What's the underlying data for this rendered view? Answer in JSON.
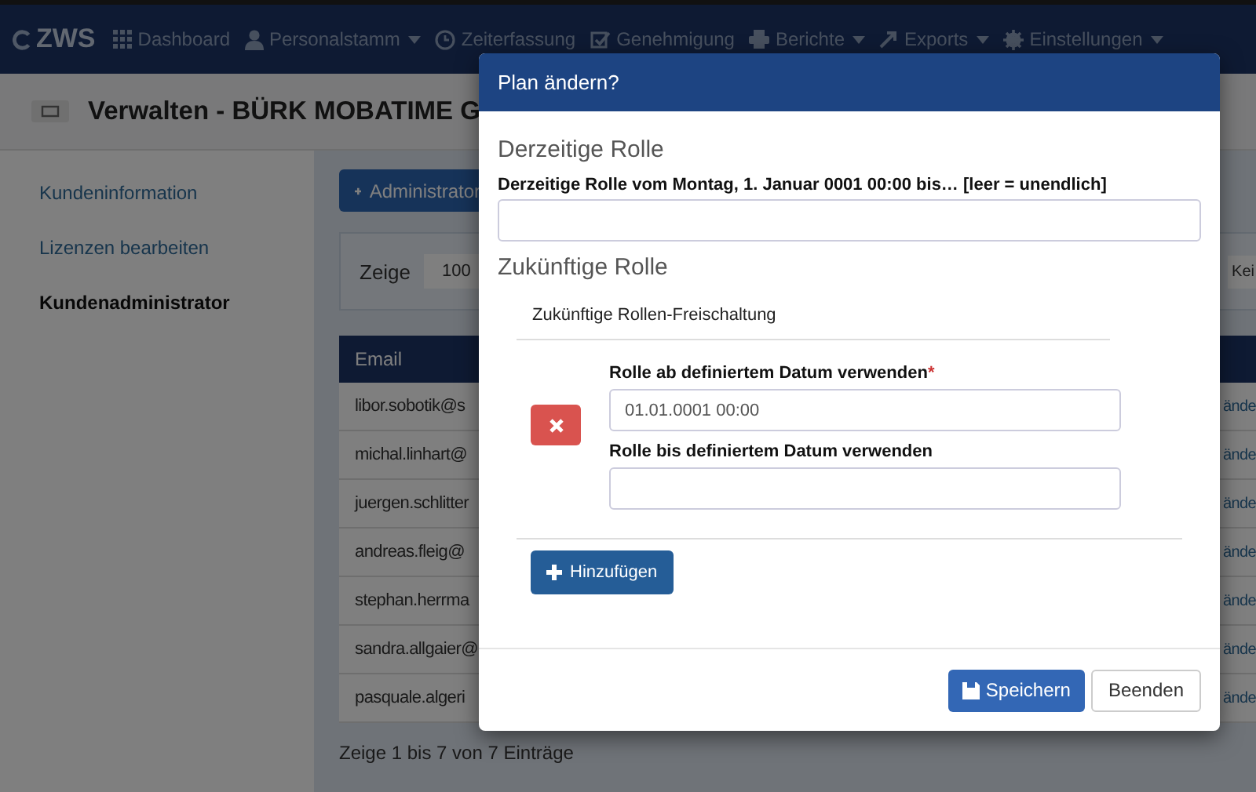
{
  "navbar": {
    "logo": "ZWS",
    "items": [
      {
        "label": "Dashboard",
        "kind": "grid",
        "dropdown": false
      },
      {
        "label": "Personalstamm",
        "kind": "user",
        "dropdown": true
      },
      {
        "label": "Zeiterfassung",
        "kind": "clock",
        "dropdown": false
      },
      {
        "label": "Genehmigung",
        "kind": "check",
        "dropdown": false
      },
      {
        "label": "Berichte",
        "kind": "print",
        "dropdown": true
      },
      {
        "label": "Exports",
        "kind": "export",
        "dropdown": true
      },
      {
        "label": "Einstellungen",
        "kind": "gear",
        "dropdown": true
      }
    ]
  },
  "page_title": "Verwalten - BÜRK MOBATIME G",
  "sidebar": {
    "items": [
      {
        "label": "Kundeninformation",
        "selected": false
      },
      {
        "label": "Lizenzen bearbeiten",
        "selected": false
      },
      {
        "label": "Kundenadministrator",
        "selected": true
      }
    ]
  },
  "add_button": "Administrator",
  "filter": {
    "show_label": "Zeige",
    "page_size": "100",
    "column_2": "Kei"
  },
  "table": {
    "columns": [
      "Email"
    ],
    "rows": [
      {
        "email": "libor.sobotik@s",
        "action": "ände"
      },
      {
        "email": "michal.linhart@",
        "action": "ände"
      },
      {
        "email": "juergen.schlitter",
        "action": "ände"
      },
      {
        "email": "andreas.fleig@",
        "action": "ände"
      },
      {
        "email": "stephan.herrma",
        "action": "ände"
      },
      {
        "email": "sandra.allgaier@",
        "action": "ände"
      },
      {
        "email": "pasquale.algeri",
        "action": "ände"
      }
    ]
  },
  "table_info": "Zeige 1 bis 7 von 7 Einträge",
  "modal": {
    "title": "Plan ändern?",
    "current_heading": "Derzeitige Rolle",
    "current_label": "Derzeitige Rolle vom Montag, 1. Januar 0001 00:00 bis… [leer = unendlich]",
    "future_heading": "Zukünftige Rolle",
    "future_subheading": "Zukünftige Rollen-Freischaltung",
    "from_label": "Rolle ab definiertem Datum verwenden",
    "from_required": "*",
    "from_value": "01.01.0001 00:00",
    "to_label": "Rolle bis definiertem Datum verwenden",
    "add_button": "Hinzufügen",
    "save_button": "Speichern",
    "close_button": "Beenden"
  }
}
